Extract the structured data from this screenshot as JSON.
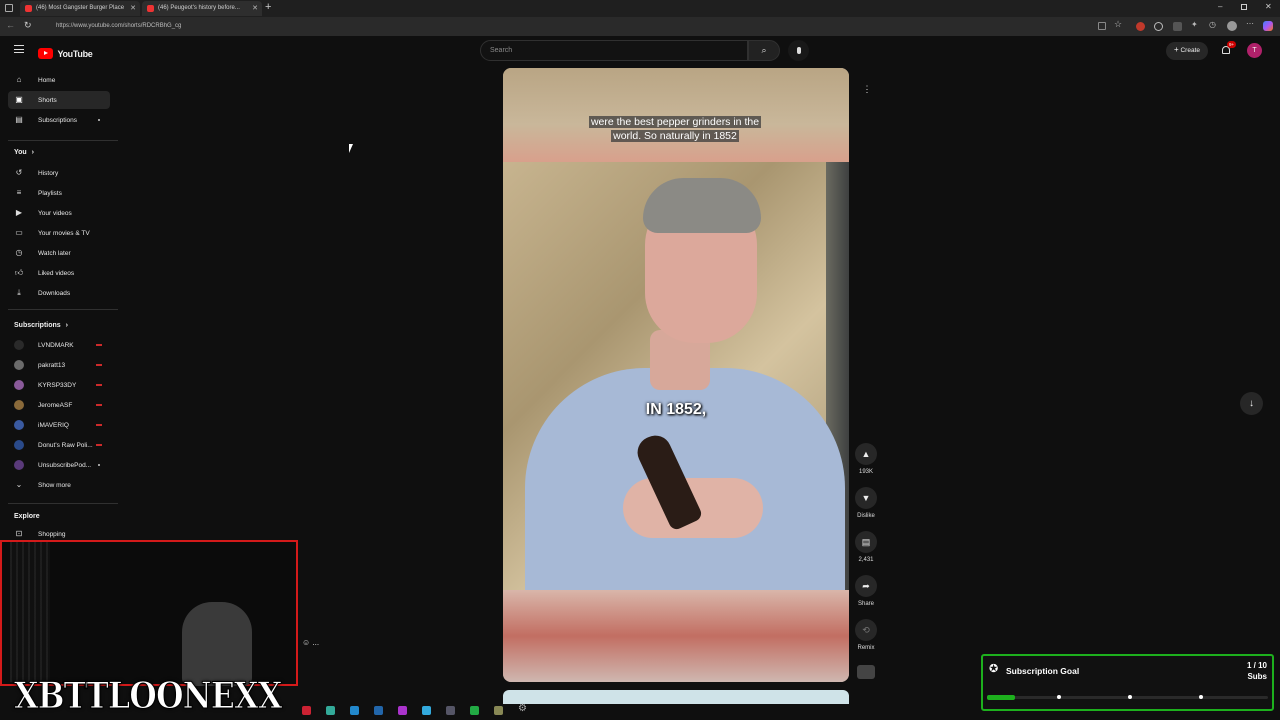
{
  "browser": {
    "tabs": [
      {
        "title": "(46) Most Gangster Burger Place"
      },
      {
        "title": "(46) Peugeot's history before..."
      }
    ],
    "url": "https://www.youtube.com/shorts/RDCRBhG_cg"
  },
  "youtube": {
    "logo": "YouTube",
    "search_placeholder": "Search",
    "create_label": "Create",
    "notif_count": "9+",
    "user_initial": "T"
  },
  "sidebar": {
    "main": [
      {
        "label": "Home",
        "icon": "home-icon"
      },
      {
        "label": "Shorts",
        "icon": "shorts-icon"
      },
      {
        "label": "Subscriptions",
        "icon": "subscriptions-icon"
      }
    ],
    "you_header": "You",
    "you_items": [
      {
        "label": "History"
      },
      {
        "label": "Playlists"
      },
      {
        "label": "Your videos"
      },
      {
        "label": "Your movies & TV"
      },
      {
        "label": "Watch later"
      },
      {
        "label": "Liked videos"
      },
      {
        "label": "Downloads"
      }
    ],
    "subs_header": "Subscriptions",
    "subs": [
      {
        "label": "LVNDMARK",
        "color": "#444444"
      },
      {
        "label": "pakratt13",
        "color": "#6b6b6b"
      },
      {
        "label": "KYRSP33DY",
        "color": "#8a5a9a"
      },
      {
        "label": "JeromeASF",
        "color": "#8a6a3a"
      },
      {
        "label": "iMAVERIQ",
        "color": "#3a5aa0"
      },
      {
        "label": "Donut's Raw Poli...",
        "color": "#2a4a8a"
      },
      {
        "label": "UnsubscribePod...",
        "color": "#5a3a7a"
      }
    ],
    "show_more": "Show more",
    "explore_header": "Explore",
    "explore_items": [
      {
        "label": "Shopping"
      }
    ]
  },
  "video": {
    "caption_line1": "were the best pepper grinders in the",
    "caption_line2": "world. So naturally in 1852",
    "burned_caption": "IN 1852,"
  },
  "actions": {
    "likes": "193K",
    "dislike": "Dislike",
    "comments": "2,431",
    "share": "Share",
    "remix": "Remix"
  },
  "stream_overlay": {
    "watermark": "XBTTLOONEXX",
    "goal_title": "Subscription Goal",
    "goal_count": "1 / 10",
    "goal_unit": "Subs",
    "goal_progress": 0.1,
    "goal_color": "#1db01d"
  }
}
